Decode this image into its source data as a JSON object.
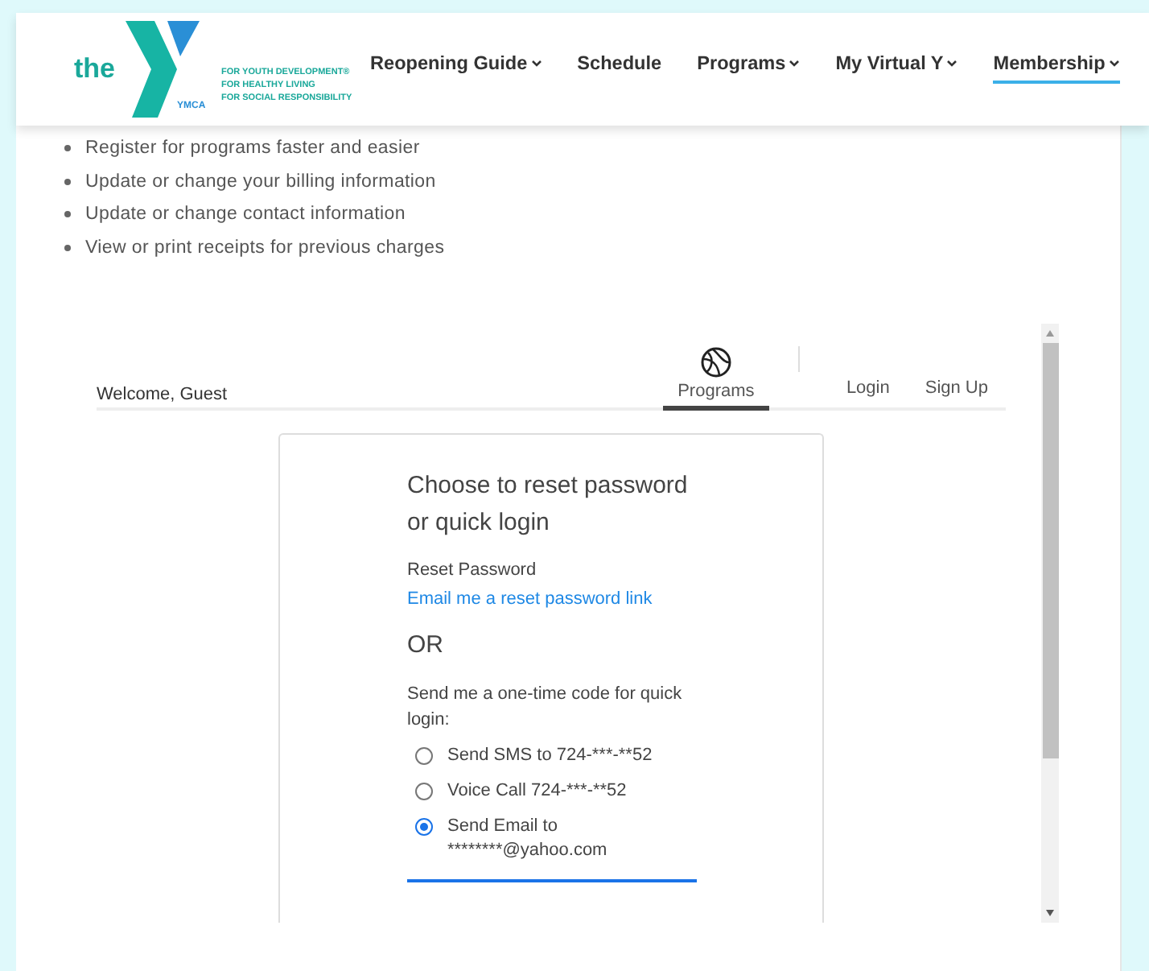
{
  "header": {
    "logo": {
      "the": "the",
      "mark": "YMCA",
      "taglines": [
        "FOR YOUTH DEVELOPMENT®",
        "FOR HEALTHY LIVING",
        "FOR SOCIAL RESPONSIBILITY"
      ]
    },
    "nav": [
      {
        "label": "Reopening Guide",
        "dropdown": true,
        "selected": false
      },
      {
        "label": "Schedule",
        "dropdown": false,
        "selected": false
      },
      {
        "label": "Programs",
        "dropdown": true,
        "selected": false
      },
      {
        "label": "My Virtual Y",
        "dropdown": true,
        "selected": false
      },
      {
        "label": "Membership",
        "dropdown": true,
        "selected": true
      }
    ]
  },
  "benefits": [
    "Register for programs faster and easier",
    "Update or change your billing information",
    "Update or change contact information",
    "View or print receipts for previous charges"
  ],
  "widget": {
    "welcome": "Welcome, Guest",
    "tabs": [
      {
        "label": "Programs",
        "selected": true
      }
    ],
    "links": [
      "Login",
      "Sign Up"
    ],
    "card": {
      "title": "Choose to reset password or quick login",
      "reset_label": "Reset Password",
      "reset_link": "Email me a reset password link",
      "or": "OR",
      "code_prompt": "Send me a one-time code for quick login:",
      "options": [
        {
          "label": "Send SMS to 724-***-**52",
          "selected": false
        },
        {
          "label": "Voice Call 724-***-**52",
          "selected": false
        },
        {
          "label": "Send Email to ********@yahoo.com",
          "selected": true
        }
      ]
    }
  }
}
